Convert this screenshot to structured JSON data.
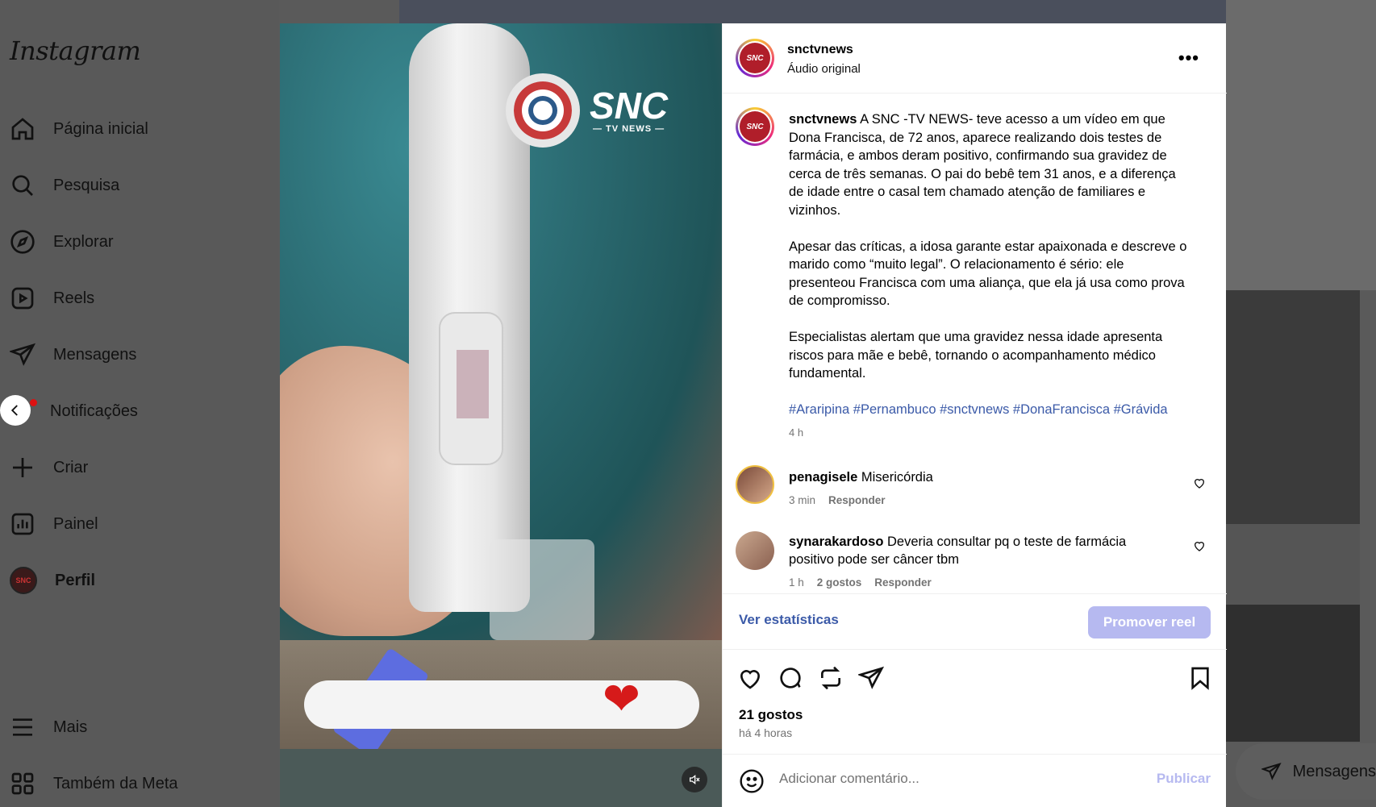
{
  "sidebar": {
    "logo": "Instagram",
    "items": [
      {
        "label": "Página inicial",
        "icon": "home-icon"
      },
      {
        "label": "Pesquisa",
        "icon": "search-icon"
      },
      {
        "label": "Explorar",
        "icon": "compass-icon"
      },
      {
        "label": "Reels",
        "icon": "reels-icon"
      },
      {
        "label": "Mensagens",
        "icon": "messenger-icon"
      },
      {
        "label": "Notificações",
        "icon": "heart-icon"
      },
      {
        "label": "Criar",
        "icon": "plus-icon"
      },
      {
        "label": "Painel",
        "icon": "dashboard-icon"
      },
      {
        "label": "Perfil",
        "icon": "avatar"
      }
    ],
    "more": "Mais",
    "meta": "Também da Meta"
  },
  "media": {
    "brand": "SNC",
    "brand_sub": "— TV NEWS —",
    "avatar_text": "SNC"
  },
  "post": {
    "username": "snctvnews",
    "audio": "Áudio original",
    "more": "•••",
    "caption_user": "snctvnews",
    "caption_p1": "A SNC -TV NEWS- teve acesso a um vídeo em que Dona Francisca, de 72 anos, aparece realizando dois testes de farmácia, e ambos deram positivo, confirmando sua gravidez de cerca de três semanas. O pai do bebê tem 31 anos, e a diferença de idade entre o casal tem chamado atenção de familiares e vizinhos.",
    "caption_p2": "Apesar das críticas, a idosa garante estar apaixonada e descreve o marido como “muito legal”. O relacionamento é sério: ele presenteou Francisca com uma aliança, que ela já usa como prova de compromisso.",
    "caption_p3": "Especialistas alertam que uma gravidez nessa idade apresenta riscos para mãe e bebê, tornando o acompanhamento médico fundamental.",
    "hashtags": "#Araripina #Pernambuco #snctvnews #DonaFrancisca #Grávida",
    "caption_time": "4 h"
  },
  "comments": [
    {
      "user": "penagisele",
      "text": "Misericórdia",
      "time": "3 min",
      "reply": "Responder"
    },
    {
      "user": "synarakardoso",
      "text": "Deveria consultar pq o teste de farmácia positivo pode ser câncer tbm",
      "time": "1 h",
      "likes": "2 gostos",
      "reply": "Responder"
    }
  ],
  "footer": {
    "stats_link": "Ver estatísticas",
    "promote": "Promover reel",
    "likes": "21 gostos",
    "ago": "há 4 horas",
    "add_comment_placeholder": "Adicionar comentário...",
    "publish": "Publicar"
  },
  "messages_pill": "Mensagens",
  "colors": {
    "link": "#3b5aa8",
    "promote_bg": "#b6b9f0",
    "overlay": "#595959"
  }
}
